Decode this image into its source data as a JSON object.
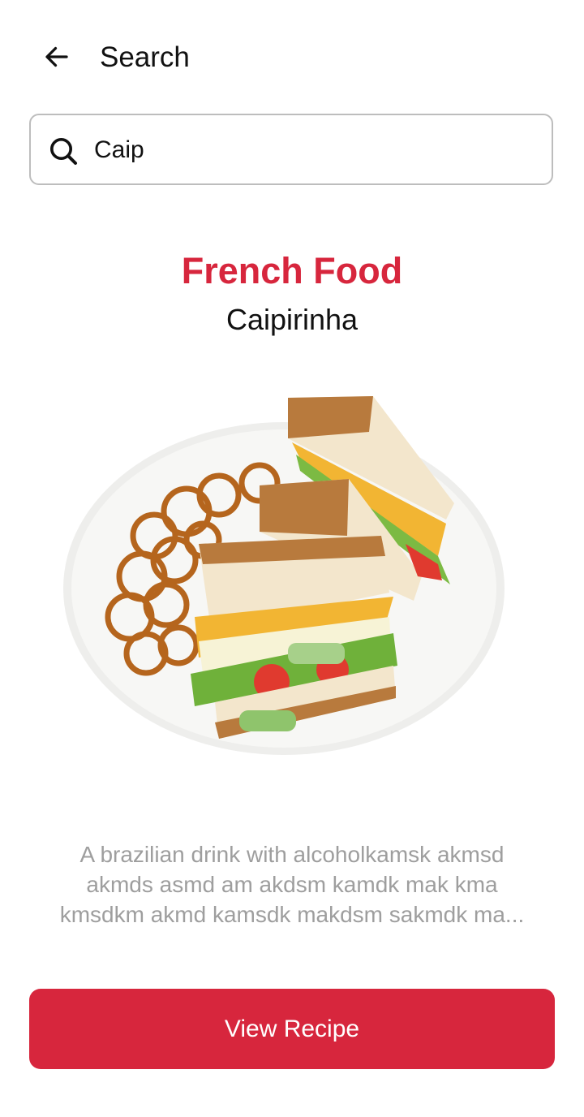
{
  "app_bar": {
    "title": "Search",
    "back_icon": "arrow-left-icon"
  },
  "search": {
    "icon": "search-icon",
    "value": "Caip"
  },
  "result": {
    "category": "French Food",
    "name": "Caipirinha",
    "image": "sandwich-with-pretzels-photo",
    "description_lines": [
      "A brazilian drink with alcoholkamsk akmsd",
      "akmds asmd am akdsm kamdk mak kma",
      "kmsdkm akmd kamsdk makdsm sakmdk ma..."
    ]
  },
  "actions": {
    "view_recipe_label": "View Recipe"
  },
  "colors": {
    "accent": "#d7263d",
    "muted_text": "#9e9e9e",
    "border": "#bdbdbd"
  }
}
